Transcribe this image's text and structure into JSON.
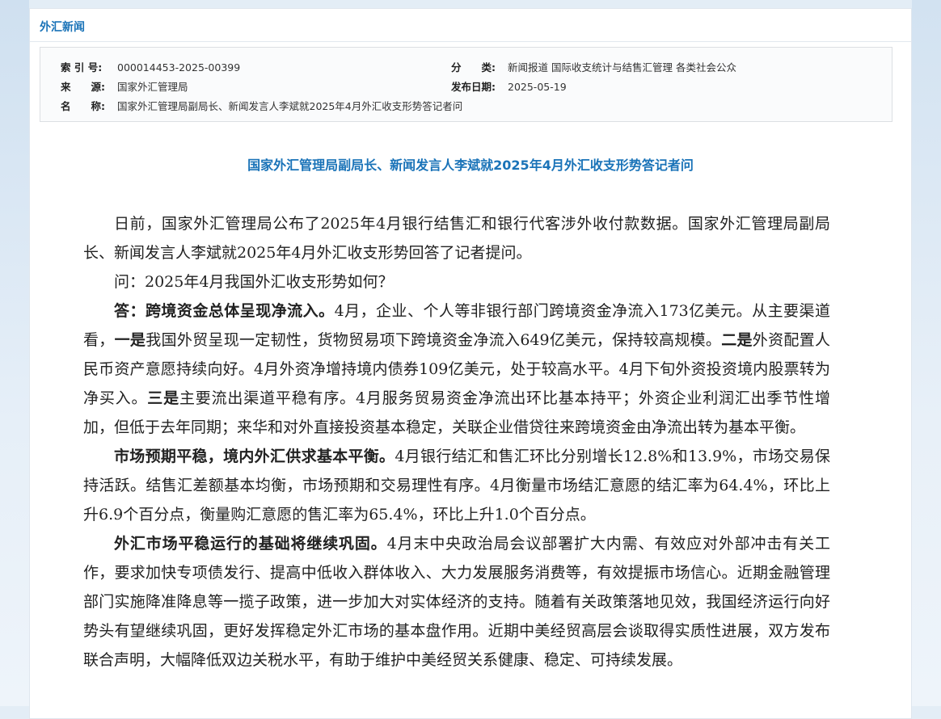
{
  "section_tab": "外汇新闻",
  "meta": {
    "index_key": "索 引 号:",
    "index_val": "000014453-2025-00399",
    "category_key": "分　　类:",
    "category_val": "新闻报道  国际收支统计与结售汇管理  各类社会公众",
    "source_key": "来　　源:",
    "source_val": "国家外汇管理局",
    "date_key": "发布日期:",
    "date_val": "2025-05-19",
    "name_key": "名　　称:",
    "name_val": "国家外汇管理局副局长、新闻发言人李斌就2025年4月外汇收支形势答记者问"
  },
  "article": {
    "title": "国家外汇管理局副局长、新闻发言人李斌就2025年4月外汇收支形势答记者问",
    "p1": "日前，国家外汇管理局公布了2025年4月银行结售汇和银行代客涉外收付款数据。国家外汇管理局副局长、新闻发言人李斌就2025年4月外汇收支形势回答了记者提问。",
    "p2": "问：2025年4月我国外汇收支形势如何？",
    "p3_a": "答：",
    "p3_b": "跨境资金总体呈现净流入。",
    "p3_c": "4月，企业、个人等非银行部门跨境资金净流入173亿美元。从主要渠道看，",
    "p3_d": "一是",
    "p3_e": "我国外贸呈现一定韧性，货物贸易项下跨境资金净流入649亿美元，保持较高规模。",
    "p3_f": "二是",
    "p3_g": "外资配置人民币资产意愿持续向好。4月外资净增持境内债券109亿美元，处于较高水平。4月下旬外资投资境内股票转为净买入。",
    "p3_h": "三是",
    "p3_i": "主要流出渠道平稳有序。4月服务贸易资金净流出环比基本持平；外资企业利润汇出季节性增加，但低于去年同期；来华和对外直接投资基本稳定，关联企业借贷往来跨境资金由净流出转为基本平衡。",
    "p4_a": "市场预期平稳，境内外汇供求基本平衡。",
    "p4_b": "4月银行结汇和售汇环比分别增长12.8%和13.9%，市场交易保持活跃。结售汇差额基本均衡，市场预期和交易理性有序。4月衡量市场结汇意愿的结汇率为64.4%，环比上升6.9个百分点，衡量购汇意愿的售汇率为65.4%，环比上升1.0个百分点。",
    "p5_a": "外汇市场平稳运行的基础将继续巩固。",
    "p5_b": "4月末中央政治局会议部署扩大内需、有效应对外部冲击有关工作，要求加快专项债发行、提高中低收入群体收入、大力发展服务消费等，有效提振市场信心。近期金融管理部门实施降准降息等一揽子政策，进一步加大对实体经济的支持。随着有关政策落地见效，我国经济运行向好势头有望继续巩固，更好发挥稳定外汇市场的基本盘作用。近期中美经贸高层会谈取得实质性进展，双方发布联合声明，大幅降低双边关税水平，有助于维护中美经贸关系健康、稳定、可持续发展。"
  }
}
